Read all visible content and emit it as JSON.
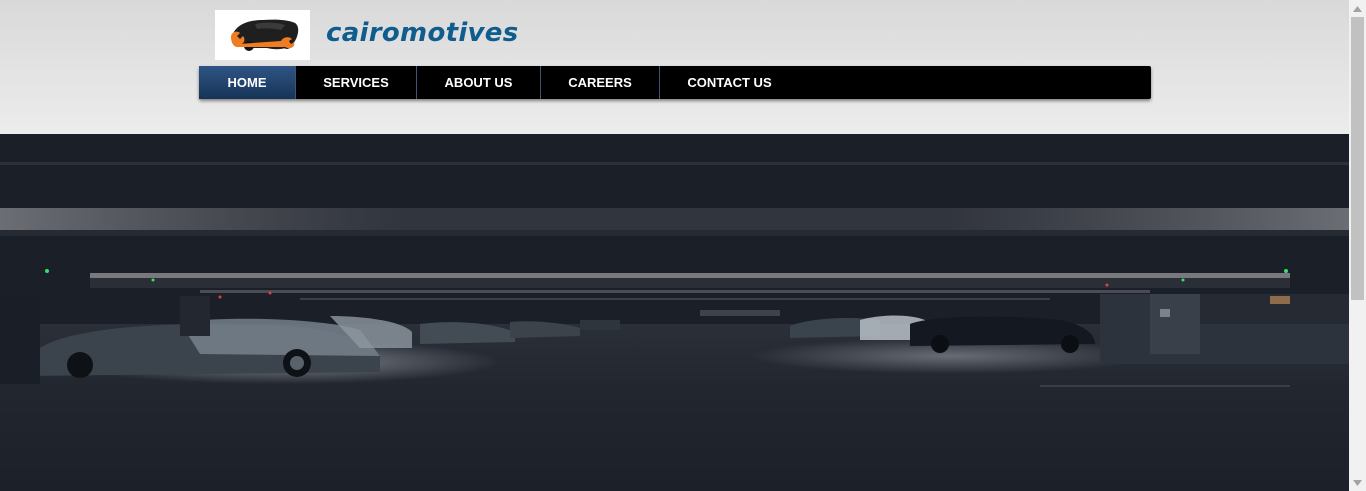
{
  "brand": {
    "name": "cairomotives",
    "logo_icon": "car-wrench-logo"
  },
  "nav": {
    "items": [
      {
        "label": "HOME",
        "active": true
      },
      {
        "label": "SERVICES",
        "active": false
      },
      {
        "label": "ABOUT US",
        "active": false
      },
      {
        "label": "CAREERS",
        "active": false
      },
      {
        "label": "CONTACT US",
        "active": false
      }
    ]
  },
  "hero": {
    "image": "parking-garage-photo"
  },
  "colors": {
    "brand_text": "#0e5d8e",
    "nav_bg": "#000000",
    "nav_active": "#1f3f66",
    "logo_orange": "#f07c22",
    "header_bg": "#e2e2e2"
  }
}
